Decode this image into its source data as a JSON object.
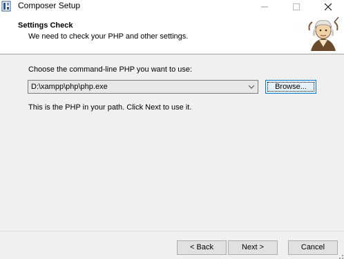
{
  "window": {
    "title": "Composer Setup",
    "minimize_icon": "minimize-icon",
    "maximize_icon": "maximize-icon",
    "close_icon": "close-icon"
  },
  "header": {
    "title": "Settings Check",
    "subtitle": "We need to check your PHP and other settings.",
    "logo_icon": "composer-logo"
  },
  "main": {
    "choose_label": "Choose the command-line PHP you want to use:",
    "php_select": {
      "value": "D:\\xampp\\php\\php.exe",
      "arrow_icon": "chevron-down-icon"
    },
    "browse_label": "Browse...",
    "path_note": "This is the PHP in your path. Click Next to use it."
  },
  "footer": {
    "back_label": "< Back",
    "next_label": "Next >",
    "cancel_label": "Cancel"
  },
  "colors": {
    "window_bg": "#f0f0f0",
    "header_bg": "#ffffff",
    "focus_border": "#0078d7",
    "focus_fill": "#e5f1fb"
  }
}
